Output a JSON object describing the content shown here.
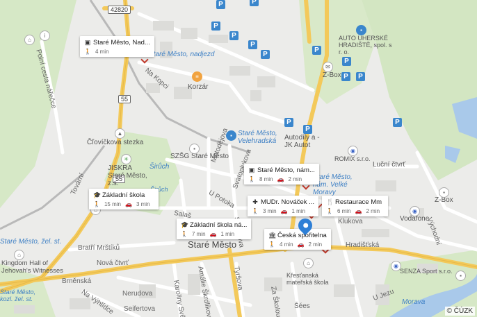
{
  "map": {
    "copyright": "© ČÚZK",
    "road_shields": [
      "42820",
      "55",
      "55"
    ],
    "labels": {
      "stare_mesto_nadjezd": "Staré Město, nadjezd",
      "na_kopci": "Na Kopci",
      "korzar": "Korzár",
      "podni_cesta": "Polní cesta nářečce",
      "clovickova": "Čľovíčkova stezka",
      "jiskra": "JISKRA Staré Město, z.s.",
      "sirjuch": "Širůch",
      "szss": "SZŠG Staré Město",
      "stare_mesto_velehradska": "Staré Město, Velehradská",
      "autodily": "Autodíly a - JK Autot",
      "romix": "ROMIX s.r.o.",
      "lucni_ctvrt": "Luční čtvrť",
      "auto_uherske": "AUTO UHERSKÉ HRADIŠTĚ, spol. s r. o.",
      "zbox1": "Z-Box",
      "zbox2": "Z-Box",
      "metodejova": "Metodějova",
      "svatoplukova": "Svatoplukova",
      "upotoka": "U Potoka",
      "salashka": "Salaš",
      "stojanova": "Stojanova",
      "stare_mesto_nam": "Staré Město, nám. Velké Moravy",
      "klukova": "Klukova",
      "hradistska": "Hradišťská",
      "vodafone": "Vodafone",
      "vychodni": "Východní",
      "bratri_mrstiku": "Bratří Mrštíků",
      "nova_ctvrt": "Nová čtvrť",
      "stare_mesto_big": "Staré Město",
      "brnenska": "Brněnská",
      "kingdom_hall": "Kingdom Hall of Jehovah's Witnesses",
      "stare_mesto_zel": "Staré Město, žel. st.",
      "nerudova": "Nerudova",
      "seifertova": "Seifertova",
      "na_vyhlidce": "Na Výhlídce",
      "karoliny_svetle": "Karoliny Světlé",
      "armade_skrinky": "Amálie Škrdlíkové",
      "tyrsova": "Tyršova",
      "za_skolou": "Za Školou",
      "kristanska": "Křesťanská mateřská škola",
      "sees": "Šées",
      "senza": "SENZA Sport s.r.o.",
      "u_jezu": "U Jezu",
      "morava": "Morava",
      "tovarni": "Tovární",
      "kozl": "Staré Město, kozl. žel. st.",
      "sirjuch2": "Širůch"
    },
    "cards": [
      {
        "title": "Staré Město, Nad...",
        "icon": "bus-icon",
        "walk": "4 min",
        "drive": ""
      },
      {
        "title": "Staré Město, nám...",
        "icon": "bus-icon",
        "walk": "8 min",
        "drive": "2 min"
      },
      {
        "title": "Základní škola",
        "icon": "school-icon",
        "walk": "15 min",
        "drive": "3 min"
      },
      {
        "title": "MUDr. Nováček ...",
        "icon": "medical-icon",
        "walk": "3 min",
        "drive": "1 min"
      },
      {
        "title": "Restaurace Mm",
        "icon": "restaurant-icon",
        "walk": "6 min",
        "drive": "2 min"
      },
      {
        "title": "Základní škola ná...",
        "icon": "school-icon",
        "walk": "7 min",
        "drive": "1 min"
      },
      {
        "title": "Česká spořitelna",
        "icon": "bank-icon",
        "walk": "4 min",
        "drive": "2 min"
      }
    ],
    "icons": {
      "walk": "walk-icon",
      "drive": "car-icon",
      "parking": "P"
    },
    "colors": {
      "background": "#ececea",
      "green": "#cfe3bd",
      "water": "#a9c9ea",
      "road_major": "#f3c95a",
      "road_minor": "#ffffff",
      "pin": "#2e7fd6",
      "parking": "#3a86cc"
    }
  }
}
